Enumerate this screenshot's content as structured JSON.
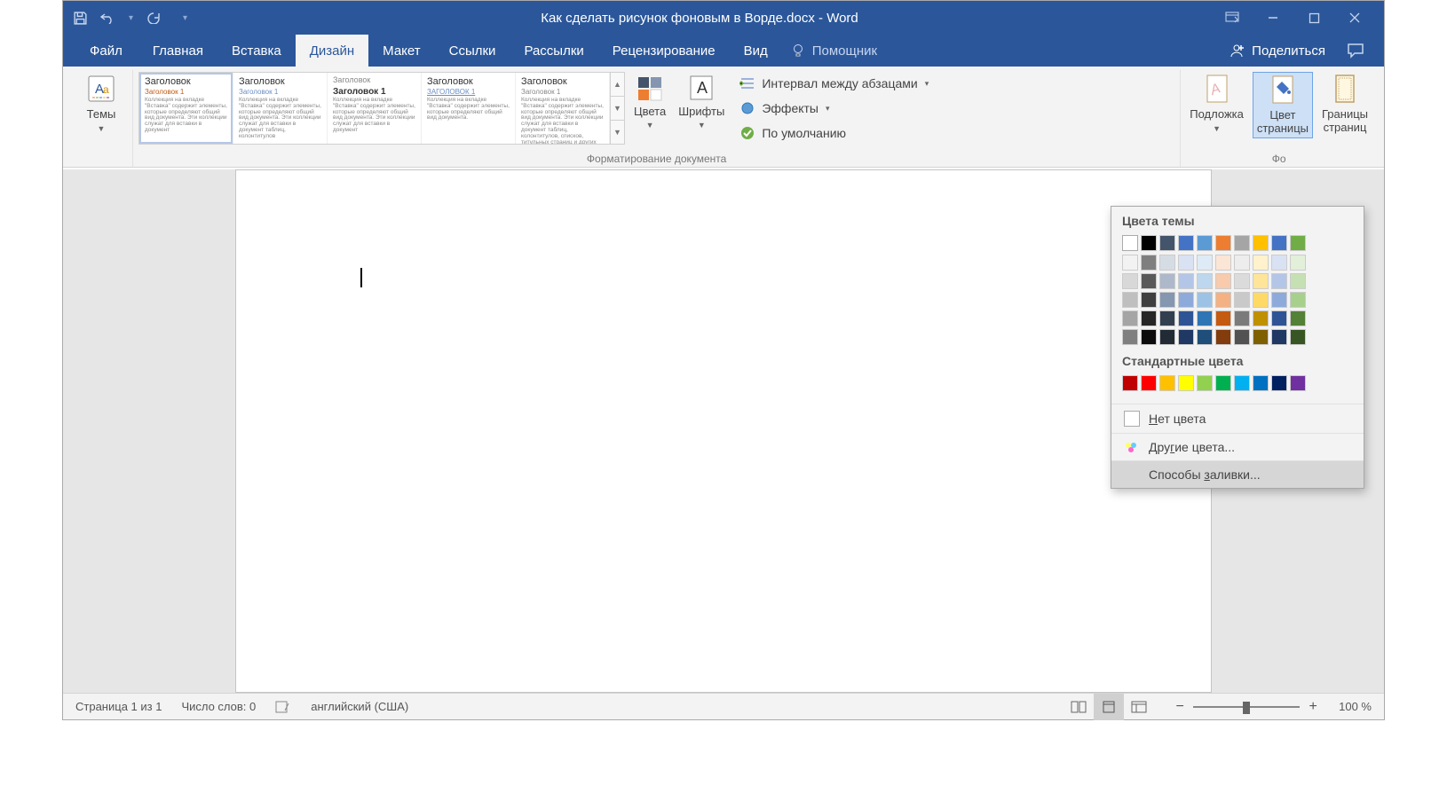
{
  "title": "Как сделать рисунок фоновым в Ворде.docx  -  Word",
  "qat": {
    "save": "save-icon",
    "undo": "↶",
    "redo": "↻",
    "more": "▾"
  },
  "tabs": [
    "Файл",
    "Главная",
    "Вставка",
    "Дизайн",
    "Макет",
    "Ссылки",
    "Рассылки",
    "Рецензирование",
    "Вид"
  ],
  "active_tab_index": 3,
  "tell_me": "Помощник",
  "share": "Поделиться",
  "ribbon": {
    "themes_label": "Темы",
    "doc_format_group_label": "Форматирование документа",
    "gallery": [
      {
        "title": "Заголовок",
        "sub": "Заголовок 1",
        "body": "Коллекция на вкладке \"Вставка\" содержит элементы, которые определяют общий вид документа. Эти коллекции служат для вставки в документ"
      },
      {
        "title": "Заголовок",
        "sub": "Заголовок 1",
        "body": "Коллекция на вкладке \"Вставка\" содержит элементы, которые определяют общий вид документа. Эти коллекции служат для вставки в документ таблиц, колонтитулов"
      },
      {
        "title": "Заголовок",
        "sub": "Заголовок 1",
        "body": "Коллекция на вкладке \"Вставка\" содержит элементы, которые определяют общий вид документа. Эти коллекции служат для вставки в документ"
      },
      {
        "title": "Заголовок",
        "sub": "ЗАГОЛОВОК 1",
        "body": "Коллекция на вкладке \"Вставка\" содержит элементы, которые определяют общий вид документа."
      },
      {
        "title": "Заголовок",
        "sub": "Заголовок 1",
        "body": "Коллекция на вкладке \"Вставка\" содержит элементы, которые определяют общий вид документа. Эти коллекции служат для вставки в документ таблиц, колонтитулов, списков, титульных страниц и других"
      }
    ],
    "colors_label": "Цвета",
    "fonts_label": "Шрифты",
    "paragraph_spacing": "Интервал между абзацами",
    "effects": "Эффекты",
    "set_default": "По умолчанию",
    "watermark_label": "Подложка",
    "page_color_label": "Цвет\nстраницы",
    "page_borders_label": "Границы\nстраниц",
    "page_bg_group_label": "Фо"
  },
  "popup": {
    "theme_colors_title": "Цвета темы",
    "standard_colors_title": "Стандартные цвета",
    "no_color": "Нет цвета",
    "more_colors": "Другие цвета...",
    "fill_effects": "Способы заливки...",
    "theme_row": [
      "#ffffff",
      "#000000",
      "#44546a",
      "#4472c4",
      "#5b9bd5",
      "#ed7d31",
      "#a5a5a5",
      "#ffc000",
      "#4472c4",
      "#70ad47"
    ],
    "theme_shades": [
      [
        "#f2f2f2",
        "#7f7f7f",
        "#d6dce4",
        "#d9e2f3",
        "#deebf6",
        "#fbe5d5",
        "#ededed",
        "#fff2cc",
        "#d9e2f3",
        "#e2efd9"
      ],
      [
        "#d8d8d8",
        "#595959",
        "#adb9ca",
        "#b4c6e7",
        "#bdd7ee",
        "#f7cbac",
        "#dbdbdb",
        "#fee599",
        "#b4c6e7",
        "#c5e0b3"
      ],
      [
        "#bfbfbf",
        "#3f3f3f",
        "#8496b0",
        "#8eaadb",
        "#9cc3e5",
        "#f4b183",
        "#c9c9c9",
        "#ffd965",
        "#8eaadb",
        "#a8d08d"
      ],
      [
        "#a5a5a5",
        "#262626",
        "#323f4f",
        "#2f5496",
        "#2e75b5",
        "#c55a11",
        "#7b7b7b",
        "#bf9000",
        "#2f5496",
        "#538135"
      ],
      [
        "#7f7f7f",
        "#0c0c0c",
        "#222a35",
        "#1f3864",
        "#1e4e79",
        "#833c0b",
        "#525252",
        "#7f6000",
        "#1f3864",
        "#375623"
      ]
    ],
    "standard_row": [
      "#c00000",
      "#ff0000",
      "#ffc000",
      "#ffff00",
      "#92d050",
      "#00b050",
      "#00b0f0",
      "#0070c0",
      "#002060",
      "#7030a0"
    ]
  },
  "status": {
    "page_info": "Страница 1 из 1",
    "word_count": "Число слов: 0",
    "language": "английский (США)",
    "zoom": "100 %"
  }
}
